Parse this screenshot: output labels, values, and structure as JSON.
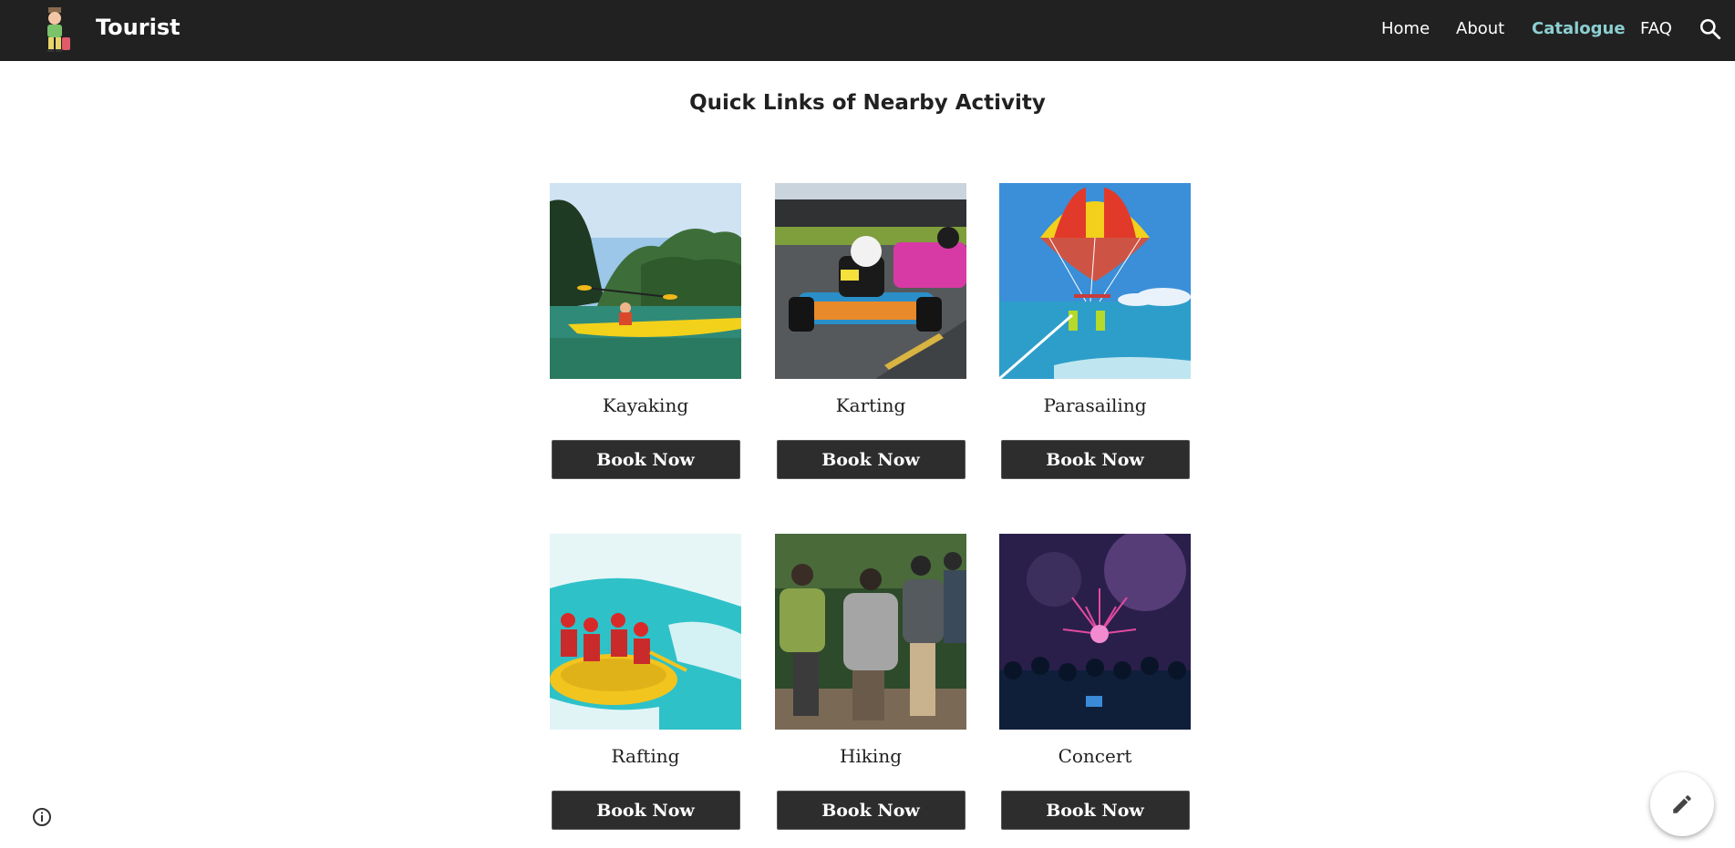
{
  "header": {
    "site_title": "Tourist",
    "nav": [
      "Home",
      "About",
      "Catalogue",
      "FAQ"
    ],
    "active_nav": "Catalogue",
    "accent_color": "#8ccfd1",
    "bar_color": "#212121"
  },
  "main": {
    "heading": "Quick Links of Nearby Activity",
    "button_label": "Book Now",
    "activities": [
      {
        "name": "Kayaking",
        "image": "kayaking-photo"
      },
      {
        "name": "Karting",
        "image": "karting-photo"
      },
      {
        "name": "Parasailing",
        "image": "parasailing-photo"
      },
      {
        "name": "Rafting",
        "image": "rafting-photo"
      },
      {
        "name": "Hiking",
        "image": "hiking-photo"
      },
      {
        "name": "Concert",
        "image": "concert-photo"
      }
    ]
  },
  "icons": {
    "search": "search-icon",
    "info": "info-icon",
    "edit": "pencil-icon",
    "logo": "tourist-logo"
  }
}
